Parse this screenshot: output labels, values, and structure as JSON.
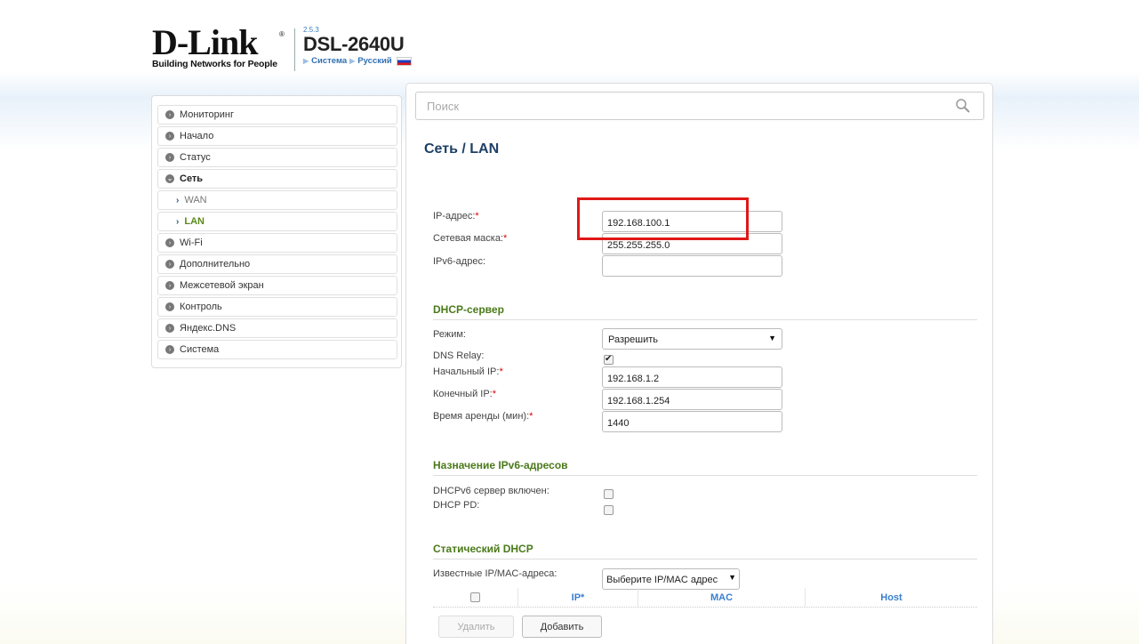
{
  "header": {
    "logo_text": "D-Link",
    "logo_tagline": "Building Networks for People",
    "firmware": "2.5.3",
    "model": "DSL-2640U",
    "breadcrumb": [
      "Система",
      "Русский"
    ]
  },
  "sidebar": {
    "items": [
      {
        "label": "Мониторинг"
      },
      {
        "label": "Начало"
      },
      {
        "label": "Статус"
      },
      {
        "label": "Сеть"
      },
      {
        "label": "WAN"
      },
      {
        "label": "LAN"
      },
      {
        "label": "Wi-Fi"
      },
      {
        "label": "Дополнительно"
      },
      {
        "label": "Межсетевой экран"
      },
      {
        "label": "Контроль"
      },
      {
        "label": "Яндекс.DNS"
      },
      {
        "label": "Система"
      }
    ]
  },
  "search": {
    "placeholder": "Поиск",
    "icon": "search-icon"
  },
  "page_title": "Сеть /  LAN",
  "lan": {
    "ip_label": "IP-адрес:",
    "ip_value": "192.168.100.1",
    "mask_label": "Сетевая маска:",
    "mask_value": "255.255.255.0",
    "ipv6_label": "IPv6-адрес:",
    "ipv6_value": ""
  },
  "dhcp": {
    "section_title": "DHCP-сервер",
    "mode_label": "Режим:",
    "mode_value": "Разрешить",
    "dns_relay_label": "DNS Relay:",
    "dns_relay_checked": true,
    "start_ip_label": "Начальный IP:",
    "start_ip_value": "192.168.1.2",
    "end_ip_label": "Конечный IP:",
    "end_ip_value": "192.168.1.254",
    "lease_label": "Время аренды (мин):",
    "lease_value": "1440"
  },
  "ipv6": {
    "section_title": "Назначение IPv6-адресов",
    "dhcpv6_label": "DHCPv6 сервер включен:",
    "dhcp_pd_label": "DHCP PD:"
  },
  "static_dhcp": {
    "section_title": "Статический DHCP",
    "known_label": "Известные IP/MAC-адреса:",
    "known_select": "Выберите IP/MAC адрес",
    "columns": [
      "IP*",
      "MAC",
      "Host"
    ],
    "delete_button": "Удалить",
    "add_button": "Добавить"
  },
  "required_mark": "*",
  "colors": {
    "accent_green": "#4a7a1a",
    "link_blue": "#3a7fd0",
    "title_blue": "#1e3f66",
    "highlight_red": "#e01818"
  }
}
